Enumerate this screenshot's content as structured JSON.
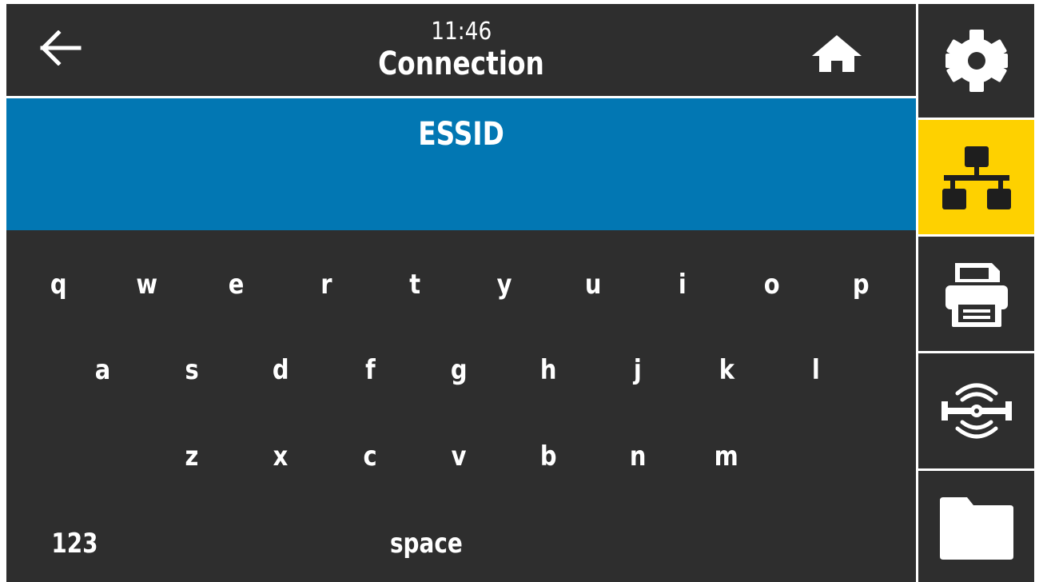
{
  "header": {
    "time": "11:46",
    "title": "Connection",
    "back_icon": "arrow-left-icon",
    "home_icon": "home-icon"
  },
  "input": {
    "label": "ESSID",
    "value": ""
  },
  "keyboard": {
    "row1": [
      "q",
      "w",
      "e",
      "r",
      "t",
      "y",
      "u",
      "i",
      "o",
      "p"
    ],
    "row2": [
      "a",
      "s",
      "d",
      "f",
      "g",
      "h",
      "j",
      "k",
      "l"
    ],
    "row3": [
      "z",
      "x",
      "c",
      "v",
      "b",
      "n",
      "m"
    ],
    "numbers_key": "123",
    "space_key": "space"
  },
  "sidebar": {
    "items": [
      {
        "icon": "gear-icon",
        "active": false
      },
      {
        "icon": "network-icon",
        "active": true
      },
      {
        "icon": "printer-icon",
        "active": false
      },
      {
        "icon": "rfid-icon",
        "active": false
      },
      {
        "icon": "folder-icon",
        "active": false
      }
    ]
  },
  "colors": {
    "background": "#2e2e2e",
    "accent_blue": "#0277b3",
    "active_yellow": "#fed100",
    "text": "#ffffff"
  }
}
